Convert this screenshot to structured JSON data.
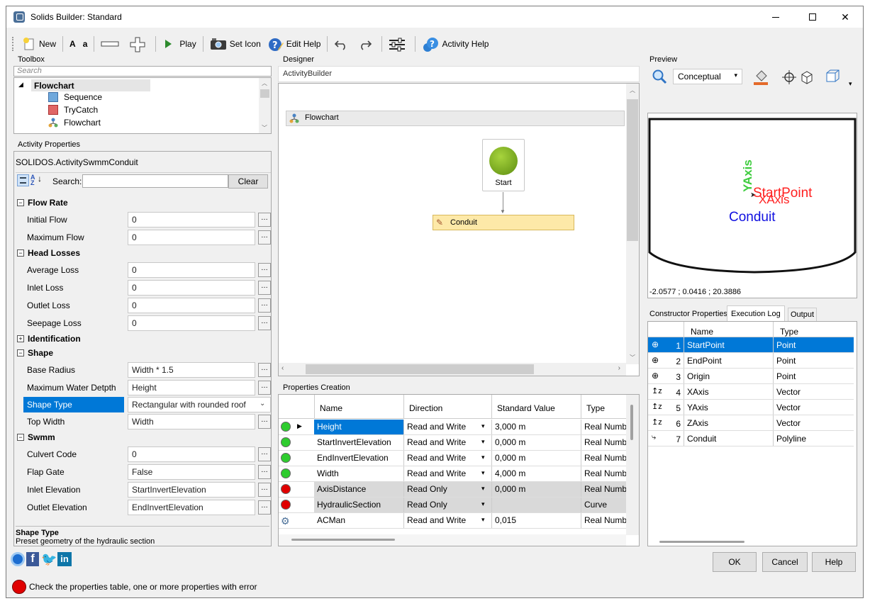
{
  "window": {
    "title": "Solids Builder: Standard"
  },
  "toolbar": {
    "new": "New",
    "font_upper": "A",
    "font_lower": "a",
    "play": "Play",
    "set_icon": "Set Icon",
    "edit_help": "Edit Help",
    "activity_help": "Activity Help"
  },
  "toolbox": {
    "label": "Toolbox",
    "search_placeholder": "Search",
    "root": "Flowchart",
    "items": [
      "Sequence",
      "TryCatch",
      "Flowchart"
    ]
  },
  "activity_properties": {
    "label": "Activity Properties",
    "class_name": "SOLIDOS.ActivitySwmmConduit",
    "search_label": "Search:",
    "clear": "Clear",
    "categories": {
      "flow_rate": "Flow Rate",
      "head_losses": "Head Losses",
      "identification": "Identification",
      "shape": "Shape",
      "swmm": "Swmm"
    },
    "flow_rate": [
      {
        "name": "Initial Flow",
        "value": "0"
      },
      {
        "name": "Maximum Flow",
        "value": "0"
      }
    ],
    "head_losses": [
      {
        "name": "Average Loss",
        "value": "0"
      },
      {
        "name": "Inlet Loss",
        "value": "0"
      },
      {
        "name": "Outlet Loss",
        "value": "0"
      },
      {
        "name": "Seepage Loss",
        "value": "0"
      }
    ],
    "shape": [
      {
        "name": "Base Radius",
        "value": "Width * 1.5"
      },
      {
        "name": "Maximum Water Detpth",
        "value": "Height"
      },
      {
        "name": "Shape Type",
        "value": "Rectangular with rounded roof"
      },
      {
        "name": "Top Width",
        "value": "Width"
      }
    ],
    "swmm": [
      {
        "name": "Culvert Code",
        "value": "0"
      },
      {
        "name": "Flap Gate",
        "value": "False"
      },
      {
        "name": "Inlet Elevation",
        "value": "StartInvertElevation"
      },
      {
        "name": "Outlet Elevation",
        "value": "EndInvertElevation"
      }
    ],
    "help_title": "Shape Type",
    "help_text": "Preset geometry of the hydraulic section"
  },
  "designer": {
    "label": "Designer",
    "breadcrumb": "ActivityBuilder",
    "flowchart": "Flowchart",
    "start": "Start",
    "conduit": "Conduit"
  },
  "properties_creation": {
    "label": "Properties Creation",
    "columns": [
      "Name",
      "Direction",
      "Standard Value",
      "Type"
    ],
    "rows": [
      {
        "status": "green",
        "name": "Height",
        "direction": "Read and Write",
        "value": "3,000 m",
        "type": "Real Numbe"
      },
      {
        "status": "green",
        "name": "StartInvertElevation",
        "direction": "Read and Write",
        "value": "0,000 m",
        "type": "Real Numbe"
      },
      {
        "status": "green",
        "name": "EndInvertElevation",
        "direction": "Read and Write",
        "value": "0,000 m",
        "type": "Real Numbe"
      },
      {
        "status": "green",
        "name": "Width",
        "direction": "Read and Write",
        "value": "4,000 m",
        "type": "Real Numbe"
      },
      {
        "status": "red",
        "name": "AxisDistance",
        "direction": "Read Only",
        "value": "0,000 m",
        "type": "Real Numbe"
      },
      {
        "status": "red",
        "name": "HydraulicSection",
        "direction": "Read Only",
        "value": "",
        "type": "Curve"
      },
      {
        "status": "gear",
        "name": "ACMan",
        "direction": "Read and Write",
        "value": "0,015",
        "type": "Real Numbe"
      }
    ]
  },
  "preview": {
    "label": "Preview",
    "visual_style": "Conceptual",
    "y_axis": "YAxis",
    "start_point": "StartPoint",
    "x_axis": "XAxis",
    "conduit": "Conduit",
    "coordinates": "-2.0577 ; 0.0416 ; 20.3886"
  },
  "tabs": [
    "Constructor Properties",
    "Execution Log",
    "Output"
  ],
  "execution_log": {
    "columns": [
      "Name",
      "Type"
    ],
    "rows": [
      {
        "index": "1",
        "name": "StartPoint",
        "type": "Point"
      },
      {
        "index": "2",
        "name": "EndPoint",
        "type": "Point"
      },
      {
        "index": "3",
        "name": "Origin",
        "type": "Point"
      },
      {
        "index": "4",
        "name": "XAxis",
        "type": "Vector"
      },
      {
        "index": "5",
        "name": "YAxis",
        "type": "Vector"
      },
      {
        "index": "6",
        "name": "ZAxis",
        "type": "Vector"
      },
      {
        "index": "7",
        "name": "Conduit",
        "type": "Polyline"
      }
    ]
  },
  "footer": {
    "ok": "OK",
    "cancel": "Cancel",
    "help": "Help",
    "status": "Check the properties table, one or more properties with error"
  },
  "colors": {
    "selection": "#0078d7",
    "green_status": "#2ecc2e",
    "red_status": "#e00000",
    "conduit_node": "#fde9a8",
    "preview_y": "#3fcc3f",
    "preview_red": "#ff2020",
    "preview_blue": "#1010e0"
  }
}
